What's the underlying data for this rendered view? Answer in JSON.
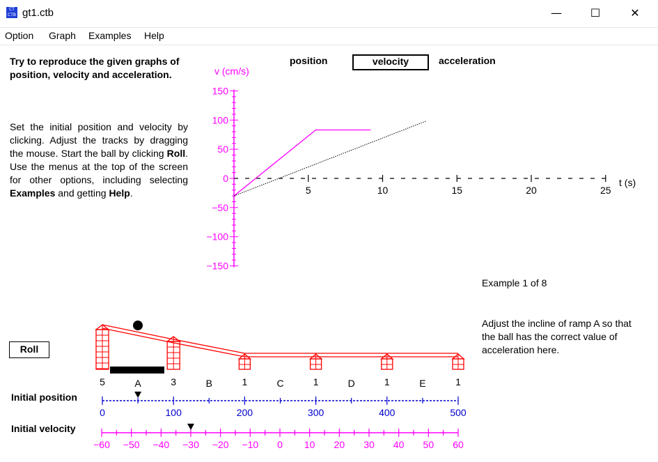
{
  "window": {
    "title": "gt1.ctb"
  },
  "window_controls": {
    "minimize": "—",
    "maximize": "☐",
    "close": "✕"
  },
  "menu": [
    "Option",
    "Graph",
    "Examples",
    "Help"
  ],
  "instructions": {
    "heading": "Try to reproduce the given graphs of position, velocity and acceleration.",
    "body_pre": "Set the initial position and velocity by clicking.  Adjust the tracks by dragging the mouse.  Start the ball by clicking ",
    "roll_word": "Roll",
    "body_mid": ". Use the menus at the top of the screen for other options, including selecting ",
    "examples_word": "Examples",
    "body_mid2": " and getting ",
    "help_word": "Help",
    "body_end": "."
  },
  "graph_tabs": {
    "position": "position",
    "velocity": "velocity",
    "acceleration": "acceleration",
    "selected": "velocity"
  },
  "chart_data": {
    "type": "line",
    "ylabel": "v (cm/s)",
    "xlabel": "t (s)",
    "xlim": [
      0,
      25
    ],
    "ylim": [
      -150,
      150
    ],
    "x_ticks": [
      5,
      10,
      15,
      20,
      25
    ],
    "y_ticks": [
      150,
      100,
      50,
      0,
      -50,
      -100,
      -150
    ],
    "series": [
      {
        "style": "magenta-solid",
        "points": [
          [
            0,
            -30
          ],
          [
            5.5,
            83
          ],
          [
            9.2,
            83
          ]
        ]
      },
      {
        "style": "black-dotted",
        "points": [
          [
            0,
            -30
          ],
          [
            12.9,
            98
          ]
        ]
      }
    ]
  },
  "example": {
    "counter": "Example 1 of 8",
    "description": "Adjust the incline of ramp A so that the ball has the correct value of acceleration here."
  },
  "roll_button": "Roll",
  "tracks": {
    "post_heights": [
      "5",
      "3",
      "1",
      "1",
      "1",
      "1"
    ],
    "segments": [
      "A",
      "B",
      "C",
      "D",
      "E"
    ]
  },
  "initial_position": {
    "label": "Initial position",
    "ticks": [
      "0",
      "100",
      "200",
      "300",
      "400",
      "500"
    ],
    "value": 50
  },
  "initial_velocity": {
    "label": "Initial velocity",
    "ticks": [
      "−60",
      "−50",
      "−40",
      "−30",
      "−20",
      "−10",
      "0",
      "10",
      "20",
      "30",
      "40",
      "50",
      "60"
    ],
    "value": -30
  },
  "colors": {
    "graph": "#ff00ff",
    "position_scale": "#0000cc",
    "velocity_scale": "#ff00ff",
    "track": "#ff0000"
  }
}
